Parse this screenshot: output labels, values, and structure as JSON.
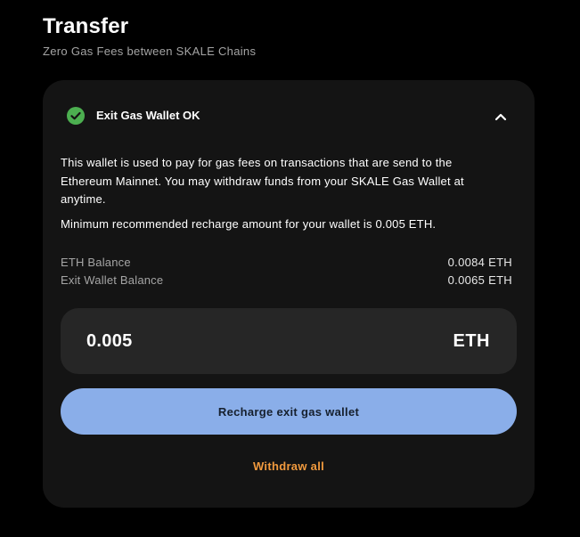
{
  "header": {
    "title": "Transfer",
    "subtitle": "Zero Gas Fees between SKALE Chains"
  },
  "panel": {
    "status_icon": "check-circle-icon",
    "status_color": "#4caf50",
    "title": "Exit Gas Wallet OK",
    "collapse_icon": "chevron-up-icon",
    "description": "This wallet is used to pay for gas fees on transactions that are send to the Ethereum Mainnet. You may withdraw funds from your SKALE Gas Wallet at anytime.",
    "min_recharge": "Minimum recommended recharge amount for your wallet is 0.005 ETH.",
    "balances": [
      {
        "label": "ETH Balance",
        "value": "0.0084 ETH"
      },
      {
        "label": "Exit Wallet Balance",
        "value": "0.0065 ETH"
      }
    ],
    "amount": {
      "value": "0.005",
      "unit": "ETH"
    },
    "recharge_button": "Recharge exit gas wallet",
    "recharge_color": "#8aaee9",
    "withdraw_link": "Withdraw all",
    "withdraw_color": "#f19a3e"
  }
}
